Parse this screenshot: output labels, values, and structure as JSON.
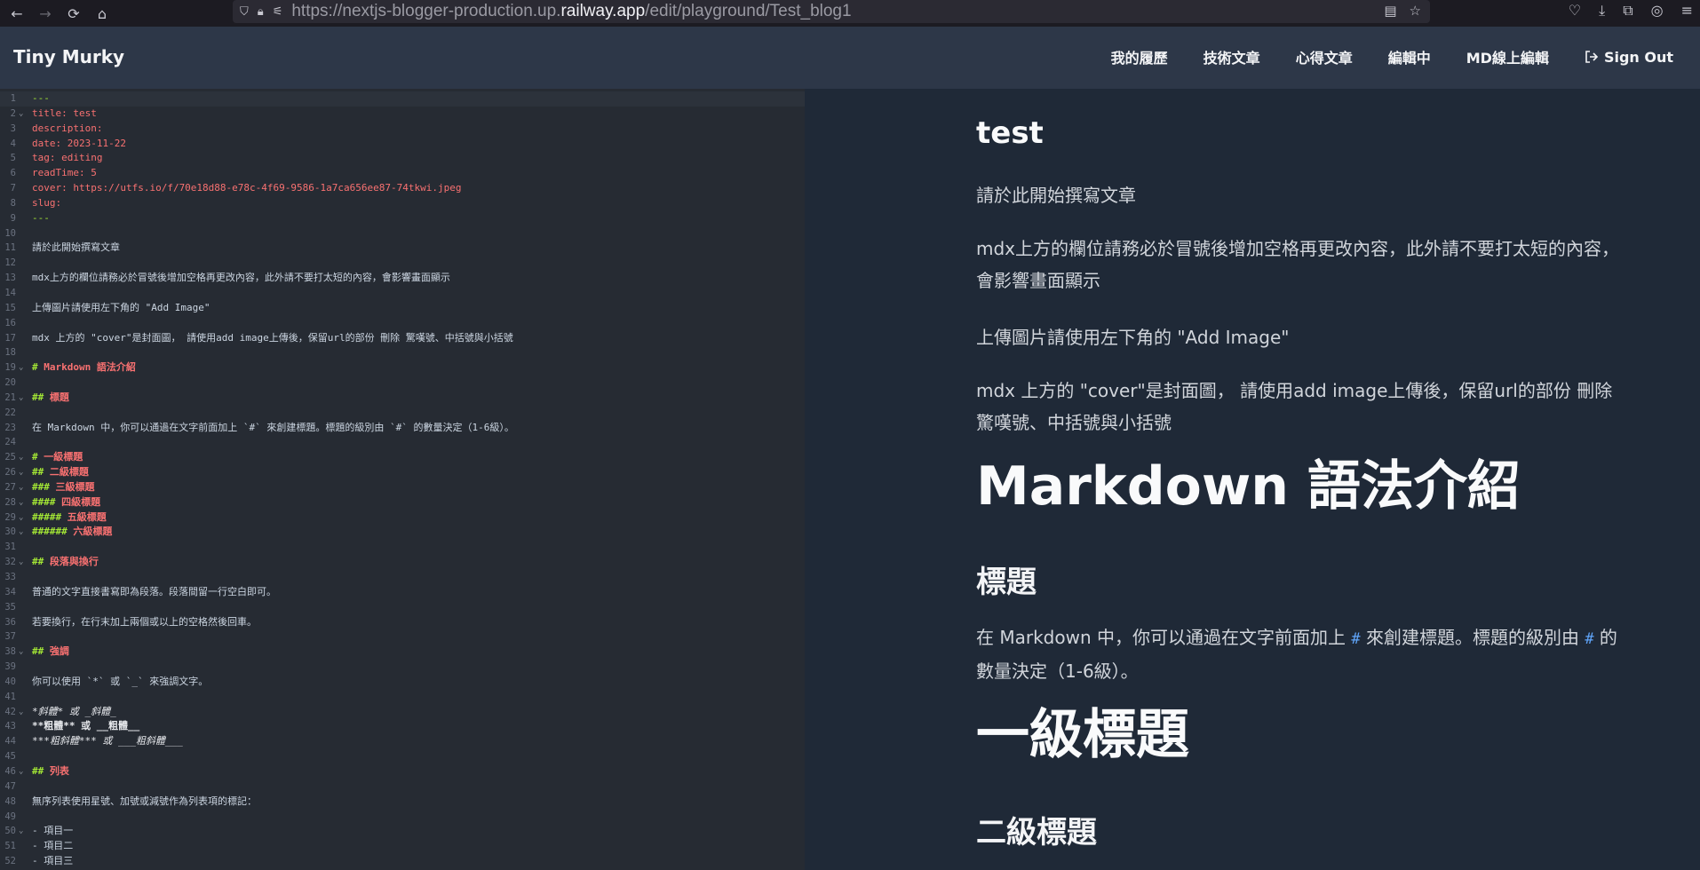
{
  "browser": {
    "url_prefix": "https://nextjs-blogger-production.up.",
    "url_host": "railway.app",
    "url_path": "/edit/playground/Test_blog1"
  },
  "header": {
    "brand": "Tiny Murky",
    "nav": [
      "我的履歷",
      "技術文章",
      "心得文章",
      "編輯中",
      "MD線上編輯"
    ],
    "signout": "Sign Out"
  },
  "editor": {
    "lines": [
      {
        "n": "1",
        "fold": false,
        "t": "---",
        "k": "dash"
      },
      {
        "n": "2",
        "fold": true,
        "t": "title: test",
        "k": "fm"
      },
      {
        "n": "3",
        "fold": false,
        "t": "description:",
        "k": "fm"
      },
      {
        "n": "4",
        "fold": false,
        "t": "date: 2023-11-22",
        "k": "fm"
      },
      {
        "n": "5",
        "fold": false,
        "t": "tag: editing",
        "k": "fm"
      },
      {
        "n": "6",
        "fold": false,
        "t": "readTime: 5",
        "k": "fm"
      },
      {
        "n": "7",
        "fold": false,
        "t": "cover: https://utfs.io/f/70e18d88-e78c-4f69-9586-1a7ca656ee87-74tkwi.jpeg",
        "k": "fm"
      },
      {
        "n": "8",
        "fold": false,
        "t": "slug:",
        "k": "fm"
      },
      {
        "n": "9",
        "fold": false,
        "t": "---",
        "k": "dash"
      },
      {
        "n": "10",
        "fold": false,
        "t": "",
        "k": "plain"
      },
      {
        "n": "11",
        "fold": false,
        "t": "請於此開始撰寫文章",
        "k": "plain"
      },
      {
        "n": "12",
        "fold": false,
        "t": "",
        "k": "plain"
      },
      {
        "n": "13",
        "fold": false,
        "t": "mdx上方的欄位請務必於冒號後增加空格再更改內容，此外請不要打太短的內容，會影響畫面顯示",
        "k": "plain"
      },
      {
        "n": "14",
        "fold": false,
        "t": "",
        "k": "plain"
      },
      {
        "n": "15",
        "fold": false,
        "t": "上傳圖片請使用左下角的 \"Add Image\"",
        "k": "plain"
      },
      {
        "n": "16",
        "fold": false,
        "t": "",
        "k": "plain"
      },
      {
        "n": "17",
        "fold": false,
        "t": "mdx 上方的 \"cover\"是封面圖， 請使用add image上傳後，保留url的部份 刪除 驚嘆號、中括號與小括號",
        "k": "plain"
      },
      {
        "n": "18",
        "fold": false,
        "t": "",
        "k": "plain"
      },
      {
        "n": "19",
        "fold": true,
        "h": "#",
        "t": " Markdown 語法介紹",
        "k": "head"
      },
      {
        "n": "20",
        "fold": false,
        "t": "",
        "k": "plain"
      },
      {
        "n": "21",
        "fold": true,
        "h": "##",
        "t": " 標題",
        "k": "head"
      },
      {
        "n": "22",
        "fold": false,
        "t": "",
        "k": "plain"
      },
      {
        "n": "23",
        "fold": false,
        "t": "在 Markdown 中，你可以通過在文字前面加上 `#` 來創建標題。標題的級別由 `#` 的數量決定（1-6級）。",
        "k": "plain"
      },
      {
        "n": "24",
        "fold": false,
        "t": "",
        "k": "plain"
      },
      {
        "n": "25",
        "fold": true,
        "h": "#",
        "t": " 一級標題",
        "k": "head"
      },
      {
        "n": "26",
        "fold": true,
        "h": "##",
        "t": " 二級標題",
        "k": "head"
      },
      {
        "n": "27",
        "fold": true,
        "h": "###",
        "t": " 三級標題",
        "k": "head"
      },
      {
        "n": "28",
        "fold": true,
        "h": "####",
        "t": " 四級標題",
        "k": "head"
      },
      {
        "n": "29",
        "fold": true,
        "h": "#####",
        "t": " 五級標題",
        "k": "head"
      },
      {
        "n": "30",
        "fold": true,
        "h": "######",
        "t": " 六級標題",
        "k": "head"
      },
      {
        "n": "31",
        "fold": false,
        "t": "",
        "k": "plain"
      },
      {
        "n": "32",
        "fold": true,
        "h": "##",
        "t": " 段落與換行",
        "k": "head"
      },
      {
        "n": "33",
        "fold": false,
        "t": "",
        "k": "plain"
      },
      {
        "n": "34",
        "fold": false,
        "t": "普通的文字直接書寫即為段落。段落間留一行空白即可。",
        "k": "plain"
      },
      {
        "n": "35",
        "fold": false,
        "t": "",
        "k": "plain"
      },
      {
        "n": "36",
        "fold": false,
        "t": "若要換行，在行末加上兩個或以上的空格然後回車。",
        "k": "plain"
      },
      {
        "n": "37",
        "fold": false,
        "t": "",
        "k": "plain"
      },
      {
        "n": "38",
        "fold": true,
        "h": "##",
        "t": " 強調",
        "k": "head"
      },
      {
        "n": "39",
        "fold": false,
        "t": "",
        "k": "plain"
      },
      {
        "n": "40",
        "fold": false,
        "t": "你可以使用 `*` 或 `_` 來強調文字。",
        "k": "plain"
      },
      {
        "n": "41",
        "fold": false,
        "t": "",
        "k": "plain"
      },
      {
        "n": "42",
        "fold": true,
        "t": "*斜體* 或 _斜體_",
        "k": "emph"
      },
      {
        "n": "43",
        "fold": false,
        "t": "**粗體** 或 __粗體__",
        "k": "strong"
      },
      {
        "n": "44",
        "fold": false,
        "t": "***粗斜體*** 或 ___粗斜體___",
        "k": "emph"
      },
      {
        "n": "45",
        "fold": false,
        "t": "",
        "k": "plain"
      },
      {
        "n": "46",
        "fold": true,
        "h": "##",
        "t": " 列表",
        "k": "head"
      },
      {
        "n": "47",
        "fold": false,
        "t": "",
        "k": "plain"
      },
      {
        "n": "48",
        "fold": false,
        "t": "無序列表使用星號、加號或減號作為列表項的標記：",
        "k": "plain"
      },
      {
        "n": "49",
        "fold": false,
        "t": "",
        "k": "plain"
      },
      {
        "n": "50",
        "fold": true,
        "t": "- 項目一",
        "k": "plain"
      },
      {
        "n": "51",
        "fold": false,
        "t": "- 項目二",
        "k": "plain"
      },
      {
        "n": "52",
        "fold": false,
        "t": "- 項目三",
        "k": "plain"
      }
    ]
  },
  "preview": {
    "title": "test",
    "p1": "請於此開始撰寫文章",
    "p2": "mdx上方的欄位請務必於冒號後增加空格再更改內容，此外請不要打太短的內容，會影響畫面顯示",
    "p3": "上傳圖片請使用左下角的 \"Add Image\"",
    "p4": "mdx 上方的 \"cover\"是封面圖， 請使用add image上傳後，保留url的部份 刪除 驚嘆號、中括號與小括號",
    "h1": "Markdown 語法介紹",
    "h2": "標題",
    "p5_a": "在 Markdown 中，你可以通過在文字前面加上 ",
    "p5_code1": "#",
    "p5_b": " 來創建標題。標題的級別由 ",
    "p5_code2": "#",
    "p5_c": " 的數量決定（1-6級）。",
    "h1_b": "一級標題",
    "h2_b": "二級標題"
  }
}
